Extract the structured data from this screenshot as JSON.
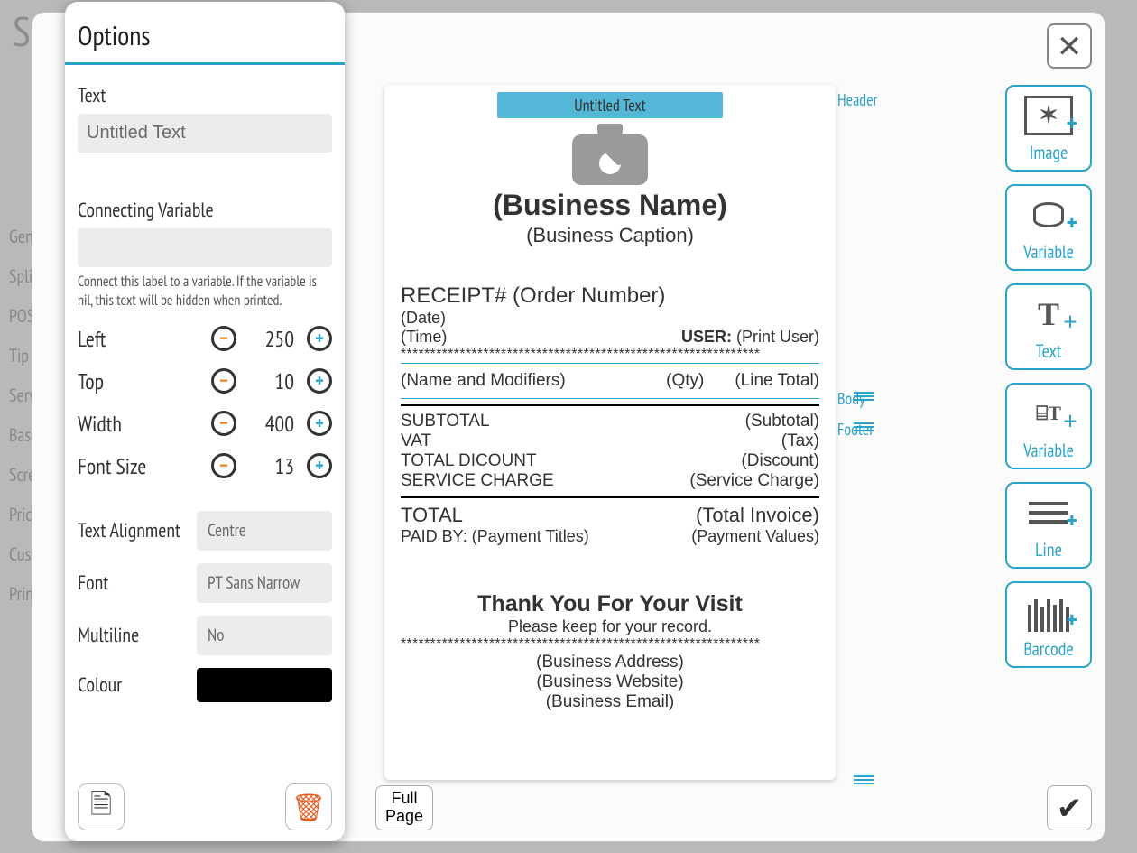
{
  "app": {
    "title_fragment": "SET",
    "side_labels": [
      "General",
      "Split",
      "POS Butt",
      "Tip",
      "Service C",
      "Basket G",
      "Screen L",
      "Price Adj",
      "Custom F",
      "Print Ten"
    ]
  },
  "options_panel": {
    "title": "Options",
    "text": {
      "label": "Text",
      "value": "Untitled Text"
    },
    "connecting_variable": {
      "label": "Connecting Variable",
      "value": "",
      "help": "Connect this label to a variable. If the variable is nil, this text will be hidden when printed."
    },
    "numeric": {
      "left": {
        "label": "Left",
        "value": 250
      },
      "top": {
        "label": "Top",
        "value": 10
      },
      "width": {
        "label": "Width",
        "value": 400
      },
      "font_size": {
        "label": "Font Size",
        "value": 13
      }
    },
    "text_alignment": {
      "label": "Text Alignment",
      "value": "Centre"
    },
    "font": {
      "label": "Font",
      "value": "PT Sans Narrow"
    },
    "multiline": {
      "label": "Multiline",
      "value": "No"
    },
    "colour": {
      "label": "Colour",
      "value": "#000000"
    }
  },
  "canvas": {
    "selected_badge": "Untitled Text",
    "business_name": "(Business Name)",
    "business_caption": "(Business Caption)",
    "receipt_label": "RECEIPT#",
    "order_number": "(Order Number)",
    "date": "(Date)",
    "time": "(Time)",
    "user_label": "USER:",
    "print_user": "(Print User)",
    "name_modifiers": "(Name and Modifiers)",
    "qty": "(Qty)",
    "line_total": "(Line Total)",
    "subtotal_l": "SUBTOTAL",
    "subtotal_r": "(Subtotal)",
    "vat_l": "VAT",
    "vat_r": "(Tax)",
    "disc_l": "TOTAL DICOUNT",
    "disc_r": "(Discount)",
    "svc_l": "SERVICE CHARGE",
    "svc_r": "(Service Charge)",
    "total_l": "TOTAL",
    "total_r": "(Total Invoice)",
    "paid_l": "PAID BY:",
    "paid_titles": "(Payment Titles)",
    "paid_values": "(Payment Values)",
    "thank": "Thank You For Your Visit",
    "keep": "Please keep for your record.",
    "biz_address": "(Business Address)",
    "biz_website": "(Business Website)",
    "biz_email": "(Business Email)",
    "stars": "*************************************************************",
    "sections": {
      "header": "Header",
      "body": "Body",
      "footer": "Footer"
    }
  },
  "toolbox": {
    "image": "Image",
    "variable1": "Variable",
    "text": "Text",
    "variable2": "Variable",
    "line": "Line",
    "barcode": "Barcode"
  },
  "footer_btn": {
    "full_page": "Full\nPage"
  }
}
